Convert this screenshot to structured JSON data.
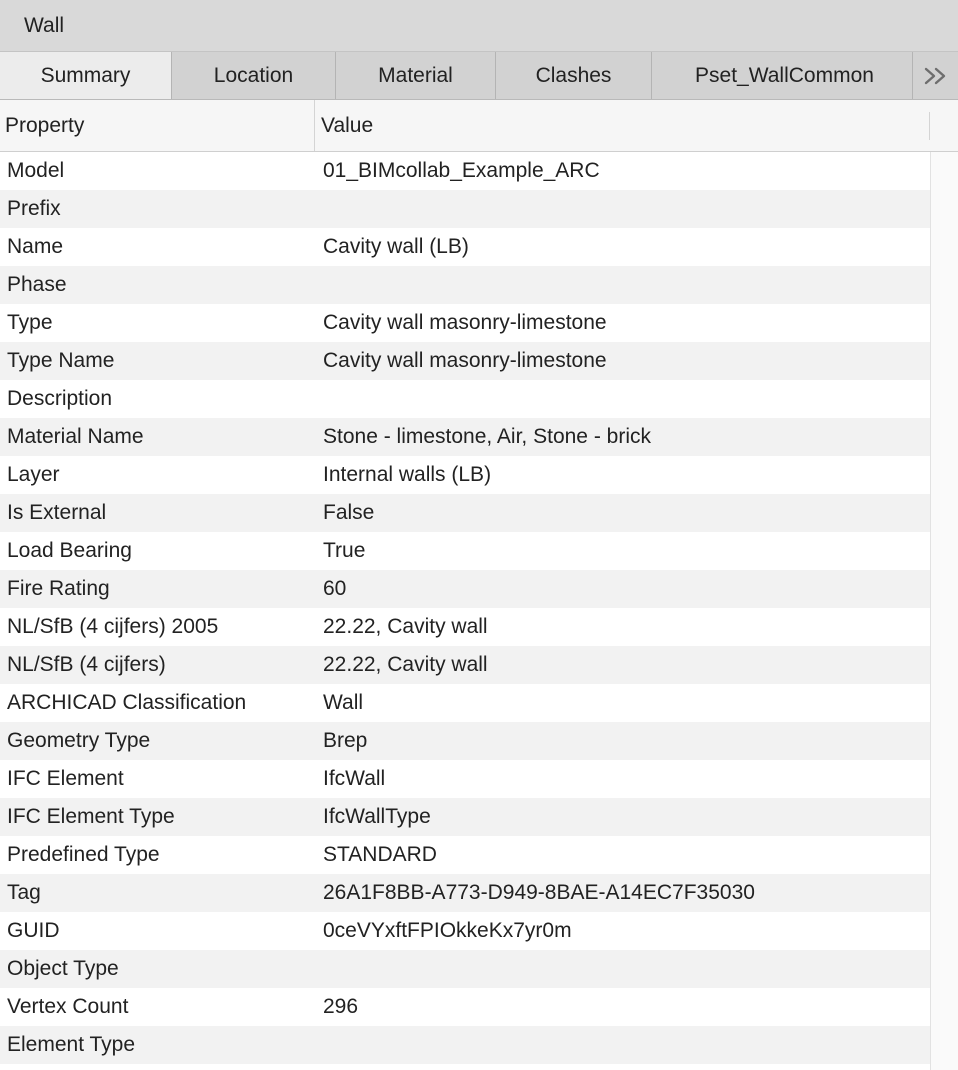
{
  "window": {
    "title": "Wall"
  },
  "tabs": [
    {
      "label": "Summary",
      "active": true
    },
    {
      "label": "Location",
      "active": false
    },
    {
      "label": "Material",
      "active": false
    },
    {
      "label": "Clashes",
      "active": false
    },
    {
      "label": "Pset_WallCommon",
      "active": false
    }
  ],
  "tab_overflow_icon": "double-chevron-right-icon",
  "table": {
    "columns": {
      "property": "Property",
      "value": "Value"
    },
    "rows": [
      {
        "property": "Model",
        "value": "01_BIMcollab_Example_ARC"
      },
      {
        "property": "Prefix",
        "value": ""
      },
      {
        "property": "Name",
        "value": "Cavity wall (LB)"
      },
      {
        "property": "Phase",
        "value": ""
      },
      {
        "property": "Type",
        "value": "Cavity wall masonry-limestone"
      },
      {
        "property": "Type Name",
        "value": "Cavity wall masonry-limestone"
      },
      {
        "property": "Description",
        "value": ""
      },
      {
        "property": "Material Name",
        "value": "Stone - limestone, Air, Stone - brick"
      },
      {
        "property": "Layer",
        "value": "Internal walls (LB)"
      },
      {
        "property": "Is External",
        "value": "False"
      },
      {
        "property": "Load Bearing",
        "value": "True"
      },
      {
        "property": "Fire Rating",
        "value": "60"
      },
      {
        "property": "NL/SfB (4 cijfers) 2005",
        "value": "22.22, Cavity wall"
      },
      {
        "property": "NL/SfB (4 cijfers)",
        "value": "22.22, Cavity wall"
      },
      {
        "property": "ARCHICAD Classification",
        "value": "Wall"
      },
      {
        "property": "Geometry Type",
        "value": "Brep"
      },
      {
        "property": "IFC Element",
        "value": "IfcWall"
      },
      {
        "property": "IFC Element Type",
        "value": "IfcWallType"
      },
      {
        "property": "Predefined Type",
        "value": "STANDARD"
      },
      {
        "property": "Tag",
        "value": "26A1F8BB-A773-D949-8BAE-A14EC7F35030"
      },
      {
        "property": "GUID",
        "value": "0ceVYxftFPIOkkeKx7yr0m"
      },
      {
        "property": "Object Type",
        "value": ""
      },
      {
        "property": "Vertex Count",
        "value": "296"
      },
      {
        "property": "Element Type",
        "value": ""
      }
    ]
  }
}
